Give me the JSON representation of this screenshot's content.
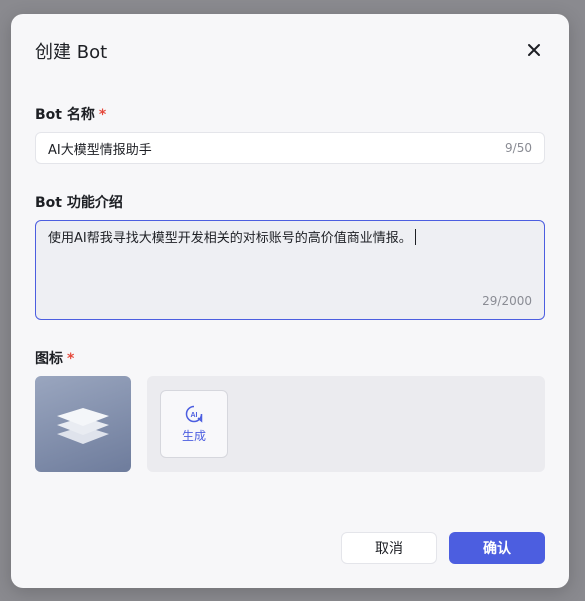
{
  "dialog": {
    "title": "创建 Bot",
    "close_icon": "close-icon"
  },
  "form": {
    "name": {
      "label": "Bot 名称",
      "required_mark": "*",
      "value": "AI大模型情报助手",
      "counter": "9/50"
    },
    "description": {
      "label": "Bot 功能介绍",
      "value": "使用AI帮我寻找大模型开发相关的对标账号的高价值商业情报。",
      "counter": "29/2000"
    },
    "icon": {
      "label": "图标",
      "required_mark": "*",
      "preview_icon": "layers-icon",
      "generate": {
        "icon": "ai-icon",
        "label": "生成"
      }
    }
  },
  "actions": {
    "cancel_label": "取消",
    "confirm_label": "确认"
  },
  "colors": {
    "accent": "#4c5ee0",
    "required": "#e5483b"
  }
}
